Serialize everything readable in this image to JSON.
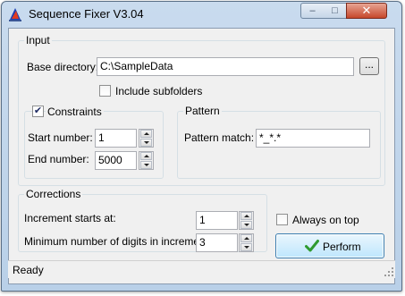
{
  "window": {
    "title": "Sequence Fixer V3.04",
    "minimize_symbol": "–",
    "maximize_symbol": "□",
    "close_symbol": "✕"
  },
  "input_group": {
    "title": "Input",
    "base_directory_label": "Base directory:",
    "base_directory_value": "C:\\SampleData",
    "browse_label": "...",
    "include_subfolders_label": "Include subfolders",
    "include_subfolders_checked": false
  },
  "constraints_group": {
    "title": "Constraints",
    "enabled": true,
    "check_mark": "✔",
    "start_number_label": "Start number:",
    "start_number_value": "1",
    "end_number_label": "End number:",
    "end_number_value": "5000"
  },
  "pattern_group": {
    "title": "Pattern",
    "pattern_match_label": "Pattern match:",
    "pattern_match_value": "*_*.*"
  },
  "corrections_group": {
    "title": "Corrections",
    "increment_starts_label": "Increment starts at:",
    "increment_starts_value": "1",
    "min_digits_label": "Minimum number of digits in increment:",
    "min_digits_value": "3"
  },
  "always_on_top": {
    "label": "Always on top",
    "checked": false
  },
  "perform_button": {
    "label": "Perform",
    "icon": "green-check-icon"
  },
  "status": {
    "text": "Ready"
  },
  "colors": {
    "title_bar": "#c9dbee",
    "close_button": "#c6472b",
    "perform_check": "#2f9a2f",
    "dialog_face": "#f0f0f0"
  }
}
